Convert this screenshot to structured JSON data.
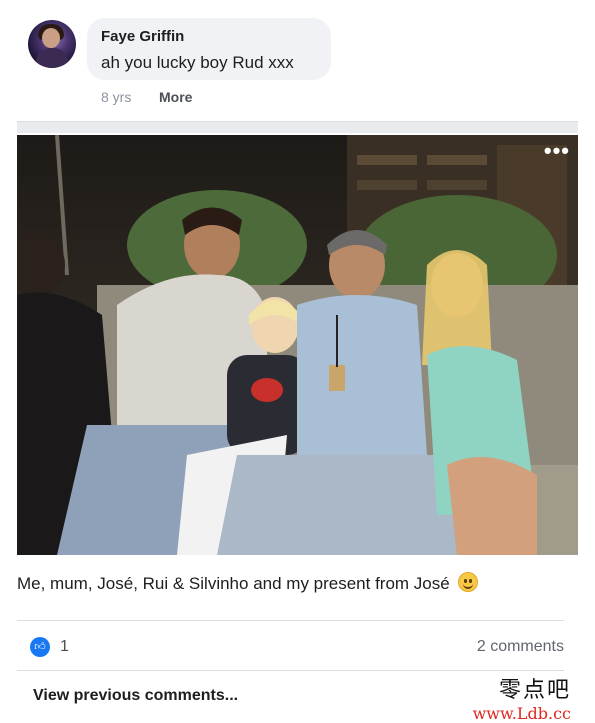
{
  "comment": {
    "author": "Faye Griffin",
    "text": "ah you lucky boy Rud xxx",
    "time": "8 yrs",
    "more_label": "More"
  },
  "photo": {
    "menu_icon": "more-horizontal-icon",
    "caption": "Me, mum, José, Rui & Silvinho and my present from José"
  },
  "reactions": {
    "like_icon": "like-thumb-icon",
    "like_count": "1",
    "comments_label": "2 comments"
  },
  "footer": {
    "view_previous": "View previous comments..."
  },
  "watermark": {
    "chinese": "零点吧",
    "url": "www.Ldb.cc"
  },
  "colors": {
    "accent": "#1877f2",
    "bubble": "#f0f2f5",
    "watermark_red": "#e0261f"
  }
}
